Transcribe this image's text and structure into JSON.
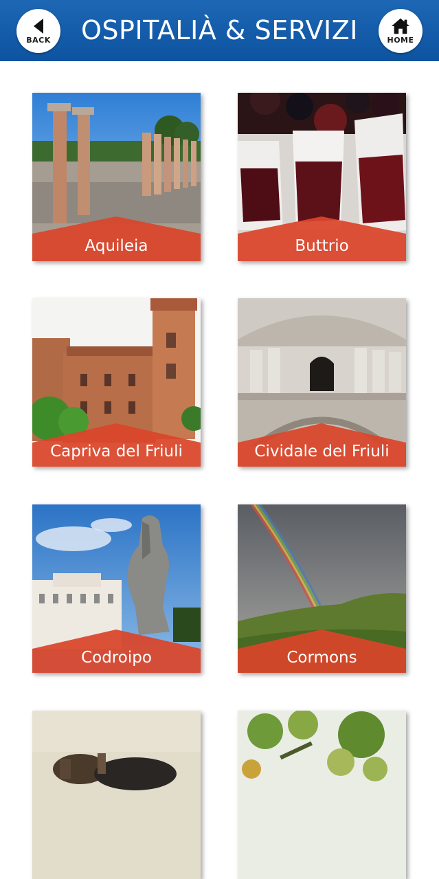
{
  "header": {
    "title": "OSPITALIÀ & SERVIZI",
    "back_label": "BACK",
    "home_label": "HOME",
    "back_icon": "back-arrow-icon",
    "home_icon": "house-icon",
    "color": "#155eab"
  },
  "tiles": [
    {
      "label": "Aquileia"
    },
    {
      "label": "Buttrio"
    },
    {
      "label": "Capriva del Friuli"
    },
    {
      "label": "Cividale del Friuli"
    },
    {
      "label": "Codroipo"
    },
    {
      "label": "Cormons"
    },
    {
      "label": ""
    },
    {
      "label": ""
    }
  ],
  "accent_color": "#d9452a"
}
